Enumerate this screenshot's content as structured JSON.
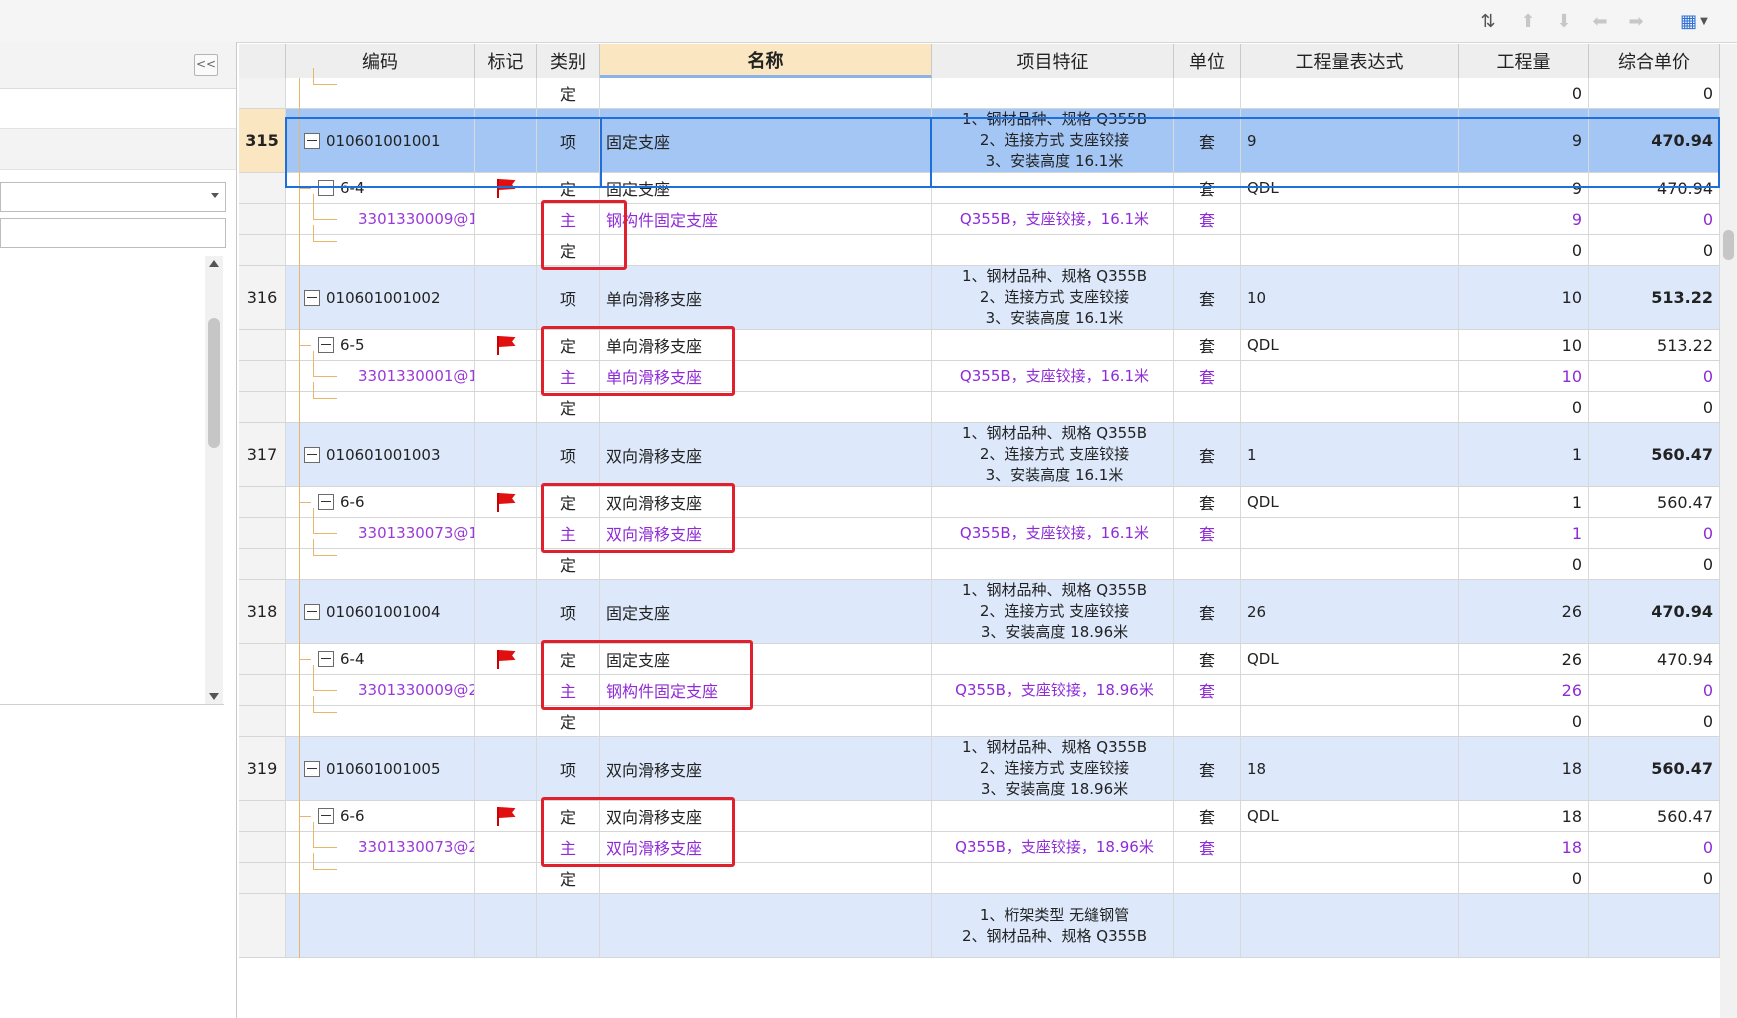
{
  "toolbar": {
    "icons": [
      "sort-icon",
      "move-up-icon",
      "move-down-icon",
      "move-left-icon",
      "move-right-icon",
      "settings-dropdown-icon"
    ]
  },
  "left_panel": {
    "collapse_label": "<<"
  },
  "columns": [
    {
      "key": "seq",
      "label": ""
    },
    {
      "key": "code",
      "label": "编码"
    },
    {
      "key": "mark",
      "label": "标记"
    },
    {
      "key": "type",
      "label": "类别"
    },
    {
      "key": "name",
      "label": "名称"
    },
    {
      "key": "feature",
      "label": "项目特征"
    },
    {
      "key": "unit",
      "label": "单位"
    },
    {
      "key": "expr",
      "label": "工程量表达式"
    },
    {
      "key": "qty",
      "label": "工程量"
    },
    {
      "key": "price",
      "label": "综合单价"
    }
  ],
  "rows": [
    {
      "kind": "sub",
      "seq": "",
      "code": "",
      "flag": false,
      "type": "定",
      "name": "",
      "feature": [],
      "unit": "",
      "expr": "",
      "qty": "0",
      "price": "0"
    },
    {
      "kind": "item",
      "selected": true,
      "seq": "315",
      "code": "010601001001",
      "flag": false,
      "type": "项",
      "name": "固定支座",
      "feature": [
        "1、钢材品种、规格 Q355B",
        "2、连接方式 支座铰接",
        "3、安装高度  16.1米"
      ],
      "unit": "套",
      "expr": "9",
      "qty": "9",
      "price": "470.94"
    },
    {
      "kind": "quota",
      "seq": "",
      "code": "6-4",
      "flag": true,
      "type": "定",
      "name": "固定支座",
      "feature": [],
      "unit": "套",
      "expr": "QDL",
      "qty": "9",
      "price": "470.94"
    },
    {
      "kind": "main",
      "seq": "",
      "code": "3301330009@1",
      "flag": false,
      "type": "主",
      "name": "钢构件固定支座",
      "feature": [
        "Q355B，支座铰接，16.1米"
      ],
      "unit": "套",
      "expr": "",
      "qty": "9",
      "price": "0"
    },
    {
      "kind": "sub",
      "seq": "",
      "code": "",
      "flag": false,
      "type": "定",
      "name": "",
      "feature": [],
      "unit": "",
      "expr": "",
      "qty": "0",
      "price": "0"
    },
    {
      "kind": "item",
      "seq": "316",
      "code": "010601001002",
      "flag": false,
      "type": "项",
      "name": "单向滑移支座",
      "feature": [
        "1、钢材品种、规格 Q355B",
        "2、连接方式 支座铰接",
        "3、安装高度  16.1米"
      ],
      "unit": "套",
      "expr": "10",
      "qty": "10",
      "price": "513.22"
    },
    {
      "kind": "quota",
      "seq": "",
      "code": "6-5",
      "flag": true,
      "type": "定",
      "name": "单向滑移支座",
      "feature": [],
      "unit": "套",
      "expr": "QDL",
      "qty": "10",
      "price": "513.22"
    },
    {
      "kind": "main",
      "seq": "",
      "code": "3301330001@1",
      "flag": false,
      "type": "主",
      "name": "单向滑移支座",
      "feature": [
        "Q355B，支座铰接，16.1米"
      ],
      "unit": "套",
      "expr": "",
      "qty": "10",
      "price": "0"
    },
    {
      "kind": "sub",
      "seq": "",
      "code": "",
      "flag": false,
      "type": "定",
      "name": "",
      "feature": [],
      "unit": "",
      "expr": "",
      "qty": "0",
      "price": "0"
    },
    {
      "kind": "item",
      "seq": "317",
      "code": "010601001003",
      "flag": false,
      "type": "项",
      "name": "双向滑移支座",
      "feature": [
        "1、钢材品种、规格 Q355B",
        "2、连接方式 支座铰接",
        "3、安装高度  16.1米"
      ],
      "unit": "套",
      "expr": "1",
      "qty": "1",
      "price": "560.47"
    },
    {
      "kind": "quota",
      "seq": "",
      "code": "6-6",
      "flag": true,
      "type": "定",
      "name": "双向滑移支座",
      "feature": [],
      "unit": "套",
      "expr": "QDL",
      "qty": "1",
      "price": "560.47"
    },
    {
      "kind": "main",
      "seq": "",
      "code": "3301330073@1",
      "flag": false,
      "type": "主",
      "name": "双向滑移支座",
      "feature": [
        "Q355B，支座铰接，16.1米"
      ],
      "unit": "套",
      "expr": "",
      "qty": "1",
      "price": "0"
    },
    {
      "kind": "sub",
      "seq": "",
      "code": "",
      "flag": false,
      "type": "定",
      "name": "",
      "feature": [],
      "unit": "",
      "expr": "",
      "qty": "0",
      "price": "0"
    },
    {
      "kind": "item",
      "seq": "318",
      "code": "010601001004",
      "flag": false,
      "type": "项",
      "name": "固定支座",
      "feature": [
        "1、钢材品种、规格 Q355B",
        "2、连接方式 支座铰接",
        "3、安装高度  18.96米"
      ],
      "unit": "套",
      "expr": "26",
      "qty": "26",
      "price": "470.94"
    },
    {
      "kind": "quota",
      "seq": "",
      "code": "6-4",
      "flag": true,
      "type": "定",
      "name": "固定支座",
      "feature": [],
      "unit": "套",
      "expr": "QDL",
      "qty": "26",
      "price": "470.94"
    },
    {
      "kind": "main",
      "seq": "",
      "code": "3301330009@2",
      "flag": false,
      "type": "主",
      "name": "钢构件固定支座",
      "feature": [
        "Q355B，支座铰接，18.96米"
      ],
      "unit": "套",
      "expr": "",
      "qty": "26",
      "price": "0"
    },
    {
      "kind": "sub",
      "seq": "",
      "code": "",
      "flag": false,
      "type": "定",
      "name": "",
      "feature": [],
      "unit": "",
      "expr": "",
      "qty": "0",
      "price": "0"
    },
    {
      "kind": "item",
      "seq": "319",
      "code": "010601001005",
      "flag": false,
      "type": "项",
      "name": "双向滑移支座",
      "feature": [
        "1、钢材品种、规格 Q355B",
        "2、连接方式 支座铰接",
        "3、安装高度  18.96米"
      ],
      "unit": "套",
      "expr": "18",
      "qty": "18",
      "price": "560.47"
    },
    {
      "kind": "quota",
      "seq": "",
      "code": "6-6",
      "flag": true,
      "type": "定",
      "name": "双向滑移支座",
      "feature": [],
      "unit": "套",
      "expr": "QDL",
      "qty": "18",
      "price": "560.47"
    },
    {
      "kind": "main",
      "seq": "",
      "code": "3301330073@2",
      "flag": false,
      "type": "主",
      "name": "双向滑移支座",
      "feature": [
        "Q355B，支座铰接，18.96米"
      ],
      "unit": "套",
      "expr": "",
      "qty": "18",
      "price": "0"
    },
    {
      "kind": "sub",
      "seq": "",
      "code": "",
      "flag": false,
      "type": "定",
      "name": "",
      "feature": [],
      "unit": "",
      "expr": "",
      "qty": "0",
      "price": "0"
    },
    {
      "kind": "item",
      "seq": "",
      "code": "",
      "flag": false,
      "type": "",
      "name": "",
      "feature": [
        "1、桁架类型 无缝钢管",
        "2、钢材品种、规格 Q355B"
      ],
      "unit": "",
      "expr": "",
      "qty": "",
      "price": ""
    }
  ],
  "colors": {
    "header_bg": "#eeeeee",
    "active_header": "#fbe6c2",
    "item_row": "#dde9fb",
    "selected_row": "#a3c6f5",
    "main_text": "#8f2bd6",
    "highlight_box": "#e0212d",
    "flag": "#e01010"
  }
}
